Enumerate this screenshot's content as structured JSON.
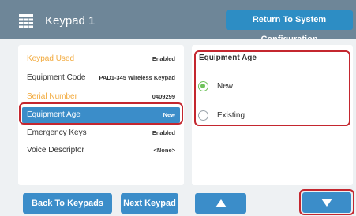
{
  "header": {
    "title": "Keypad 1",
    "return_label": "Return To System Configuration"
  },
  "settings": [
    {
      "label": "Keypad Used",
      "value": "Enabled",
      "readonly": true
    },
    {
      "label": "Equipment Code",
      "value": "PAD1-345 Wireless Keypad"
    },
    {
      "label": "Serial Number",
      "value": "0409299",
      "readonly": true
    },
    {
      "label": "Equipment Age",
      "value": "New",
      "selected": true
    },
    {
      "label": "Emergency Keys",
      "value": "Enabled"
    },
    {
      "label": "Voice Descriptor",
      "value": "<None>"
    }
  ],
  "equipment_age": {
    "title": "Equipment Age",
    "options": [
      {
        "label": "New",
        "checked": true
      },
      {
        "label": "Existing",
        "checked": false
      }
    ]
  },
  "footer": {
    "back_label": "Back To Keypads",
    "next_label": "Next Keypad"
  },
  "colors": {
    "header_bg": "#6e8698",
    "accent_blue": "#3b8dc9",
    "readonly_orange": "#f2a93b",
    "highlight_red": "#c4272f",
    "radio_green": "#6ec25a"
  }
}
